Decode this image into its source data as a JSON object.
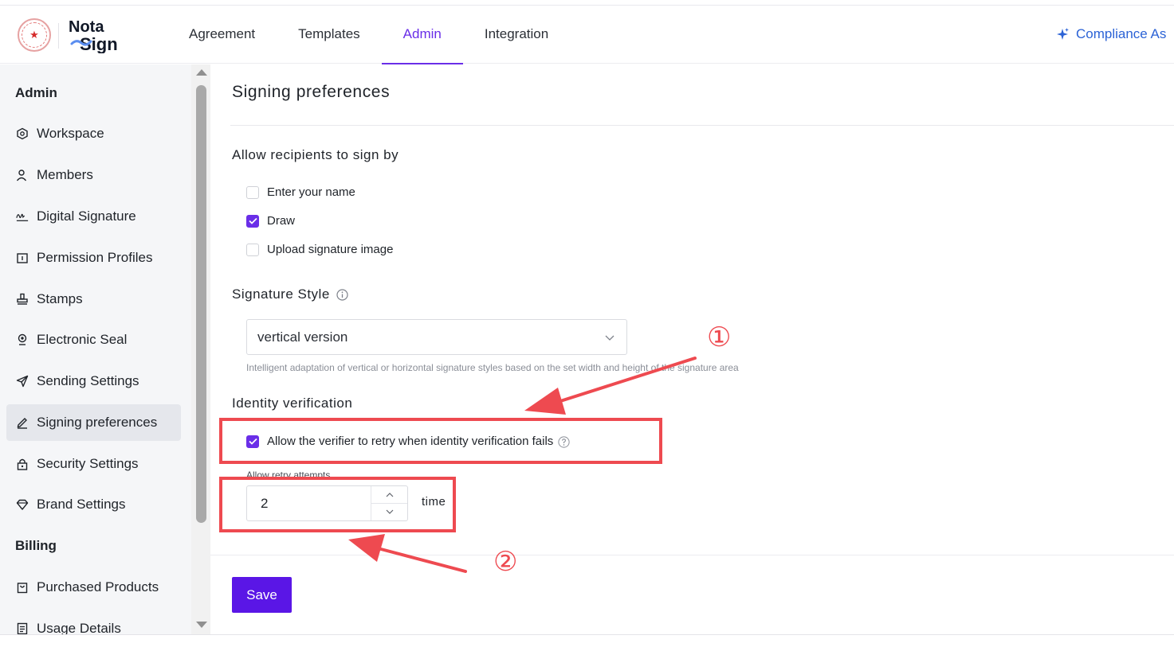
{
  "app": {
    "brand": "NotaSign",
    "brand_line1": "Nota",
    "brand_line2": "Sign",
    "brand_color": "#6a2ee8",
    "seal_glyph": "★"
  },
  "nav": {
    "items": [
      {
        "label": "Agreement"
      },
      {
        "label": "Templates"
      },
      {
        "label": "Admin",
        "active": true
      },
      {
        "label": "Integration"
      }
    ],
    "compliance_label": "Compliance As"
  },
  "sidebar": {
    "section_admin": "Admin",
    "items": [
      {
        "label": "Workspace",
        "icon": "hexagon-icon"
      },
      {
        "label": "Members",
        "icon": "user-icon"
      },
      {
        "label": "Digital Signature",
        "icon": "signature-icon"
      },
      {
        "label": "Permission Profiles",
        "icon": "id-card-icon"
      },
      {
        "label": "Stamps",
        "icon": "stamp-icon"
      },
      {
        "label": "Electronic Seal",
        "icon": "seal-pin-icon"
      },
      {
        "label": "Sending Settings",
        "icon": "send-icon"
      },
      {
        "label": "Signing preferences",
        "icon": "pen-icon",
        "active": true
      },
      {
        "label": "Security Settings",
        "icon": "lock-icon"
      },
      {
        "label": "Brand Settings",
        "icon": "diamond-icon"
      }
    ],
    "section_billing": "Billing",
    "billing_items": [
      {
        "label": "Purchased Products",
        "icon": "bag-icon"
      },
      {
        "label": "Usage Details",
        "icon": "document-icon"
      }
    ]
  },
  "page": {
    "title": "Signing preferences",
    "sign_by": {
      "title": "Allow recipients to sign by",
      "options": [
        {
          "label": "Enter your name",
          "checked": false
        },
        {
          "label": "Draw",
          "checked": true
        },
        {
          "label": "Upload signature image",
          "checked": false
        }
      ]
    },
    "signature_style": {
      "title": "Signature Style",
      "selected": "vertical version",
      "hint": "Intelligent adaptation of vertical or horizontal signature styles based on the set width and height of the signature area"
    },
    "identity": {
      "title": "Identity verification",
      "retry_option": {
        "label": "Allow the verifier to retry when identity verification fails",
        "checked": true
      },
      "retry_attempts_label": "Allow retry attempts",
      "retry_attempts_value": "2",
      "unit": "time"
    },
    "save_label": "Save"
  },
  "annotations": {
    "marker_1": "①",
    "marker_2": "②",
    "color": "#ee4a50"
  }
}
